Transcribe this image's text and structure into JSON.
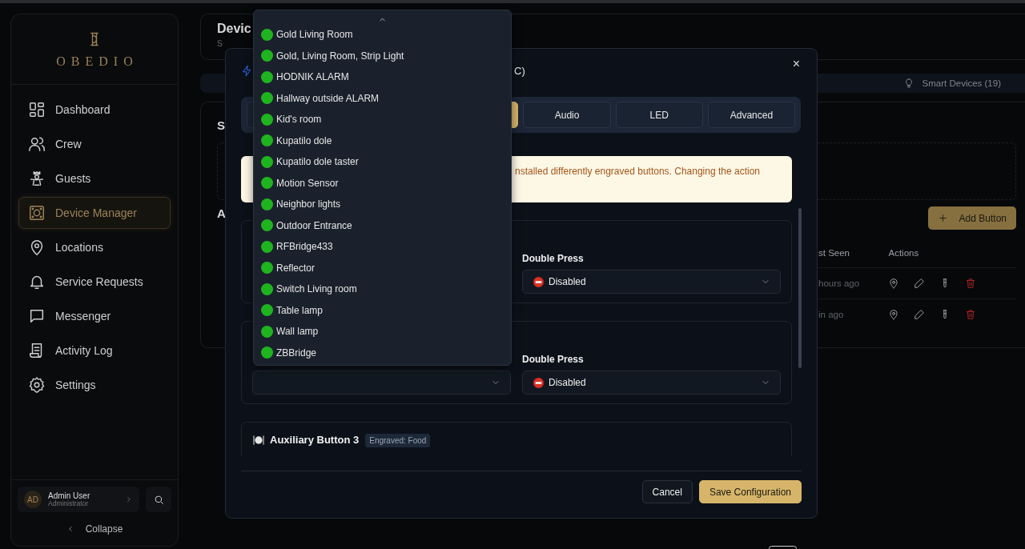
{
  "sidebar": {
    "logo": "OBEDIO",
    "nav": [
      {
        "label": "Dashboard",
        "selected": false
      },
      {
        "label": "Crew",
        "selected": false
      },
      {
        "label": "Guests",
        "selected": false
      },
      {
        "label": "Device Manager",
        "selected": true
      },
      {
        "label": "Locations",
        "selected": false
      },
      {
        "label": "Service Requests",
        "selected": false
      },
      {
        "label": "Messenger",
        "selected": false
      },
      {
        "label": "Activity Log",
        "selected": false
      },
      {
        "label": "Settings",
        "selected": false
      }
    ],
    "user": {
      "initials": "AD",
      "name": "Admin User",
      "role": "Administrator"
    },
    "collapse": "Collapse"
  },
  "page": {
    "title": "Devic",
    "subtitle": "S",
    "tab": "Smart Devices (19)",
    "section_1": "S",
    "section_2": "A",
    "add_button": "Add Button",
    "table": {
      "columns": [
        "st Seen",
        "Actions"
      ],
      "rows": [
        {
          "last_seen": "hours ago"
        },
        {
          "last_seen": "in ago"
        }
      ]
    }
  },
  "dialog": {
    "title": "C)",
    "close": "×",
    "tabs": [
      {
        "selected": false
      },
      {
        "selected": true
      },
      {
        "label": "Audio",
        "selected": false
      },
      {
        "label": "LED",
        "selected": false
      },
      {
        "label": "Advanced",
        "selected": false
      }
    ],
    "warning": "nstalled differently engraved buttons. Changing the action",
    "cards": [
      {
        "kind": "fields",
        "right": {
          "kind": "select",
          "label": "Double Press",
          "value": "Disabled"
        }
      },
      {
        "kind": "fields",
        "left": {
          "kind": "empty"
        },
        "right": {
          "kind": "select",
          "label": "Double Press",
          "value": "Disabled"
        }
      },
      {
        "kind": "header",
        "title": "Auxiliary Button 3",
        "badge": "Engraved: Food"
      }
    ],
    "buttons": [
      {
        "label": "Cancel",
        "kind": "secondary"
      },
      {
        "label": "Save Configuration",
        "kind": "primary"
      }
    ]
  },
  "dropdown": {
    "items": [
      {
        "label": "Gold Living Room",
        "online": true
      },
      {
        "label": "Gold, Living Room, Strip Light",
        "online": true
      },
      {
        "label": "HODNIK ALARM",
        "online": true
      },
      {
        "label": "Hallway outside ALARM",
        "online": true
      },
      {
        "label": "Kid's room",
        "online": true
      },
      {
        "label": "Kupatilo dole",
        "online": true
      },
      {
        "label": "Kupatilo dole taster",
        "online": true
      },
      {
        "label": "Motion Sensor",
        "online": true
      },
      {
        "label": "Neighbor lights",
        "online": true
      },
      {
        "label": "Outdoor Entrance",
        "online": true
      },
      {
        "label": "RFBridge433",
        "online": true
      },
      {
        "label": "Reflector",
        "online": true
      },
      {
        "label": "Switch Living room",
        "online": true
      },
      {
        "label": "Table lamp",
        "online": true
      },
      {
        "label": "Wall lamp",
        "online": true
      },
      {
        "label": "ZBBridge",
        "online": true
      }
    ]
  }
}
